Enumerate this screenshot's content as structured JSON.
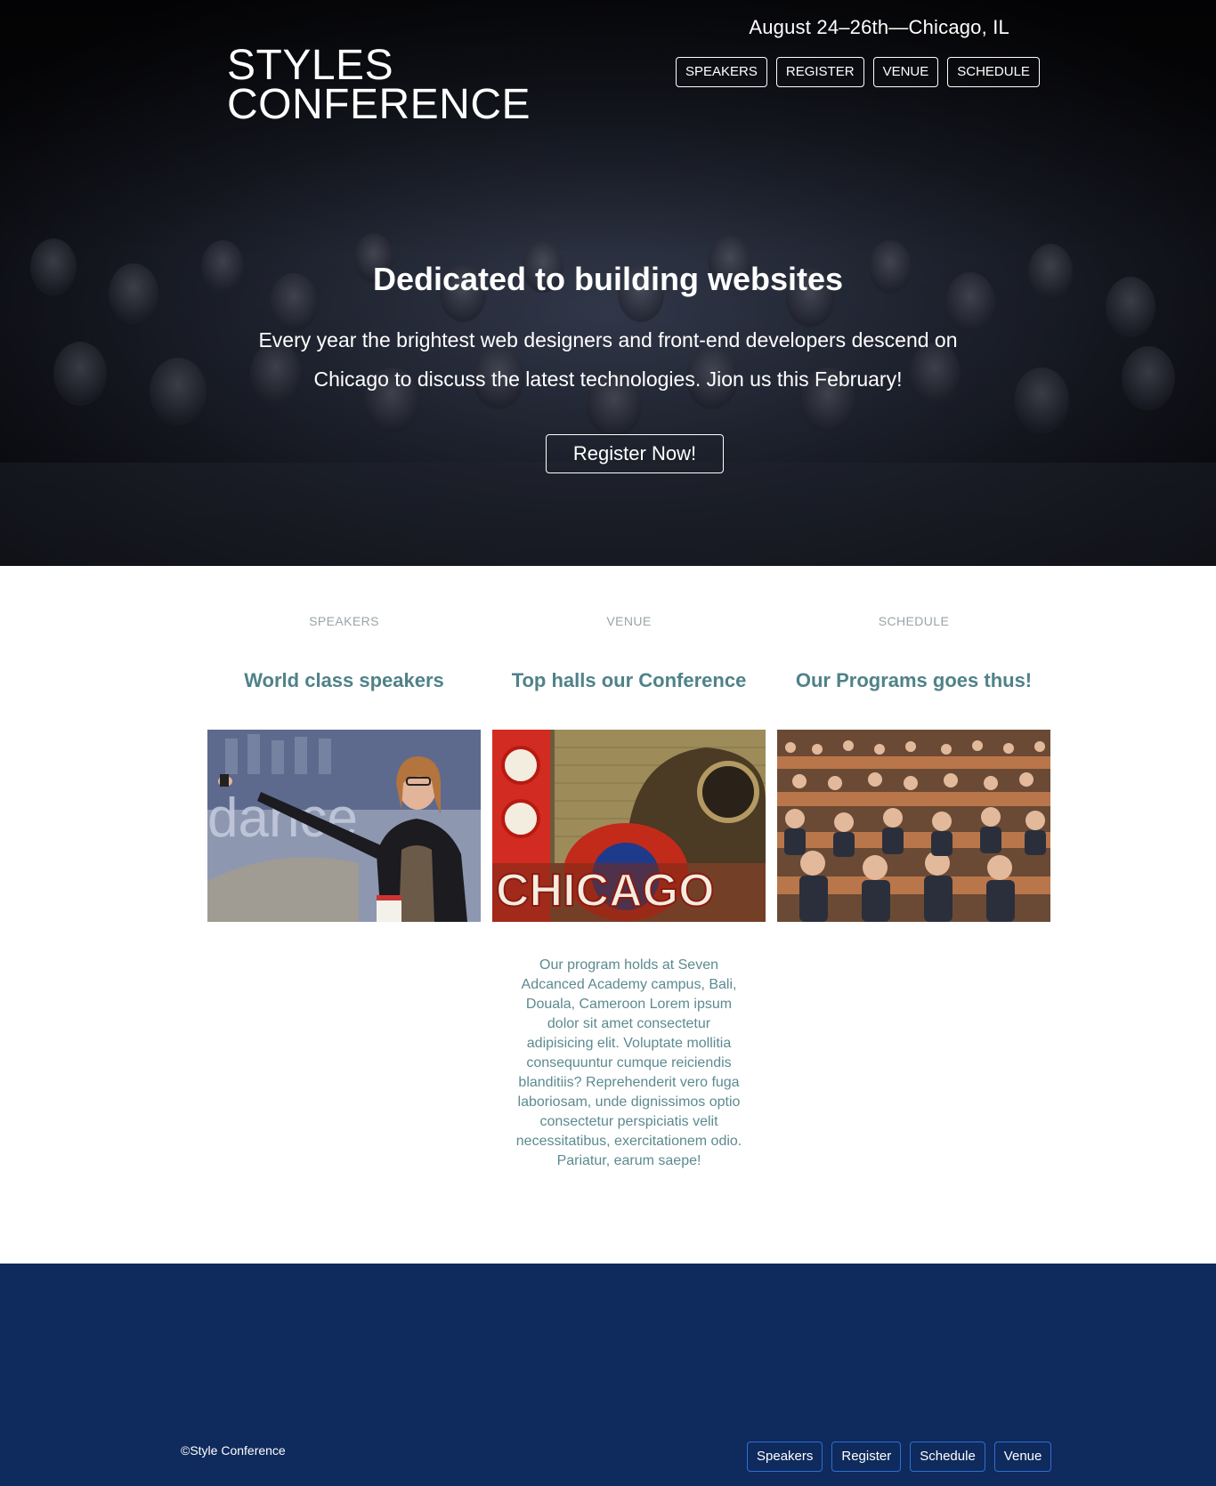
{
  "header": {
    "date_location": "August 24–26th—Chicago, IL",
    "logo_line1": "STYLES",
    "logo_line2": "CONFERENCE",
    "nav": [
      {
        "label": "SPEAKERS"
      },
      {
        "label": "REGISTER"
      },
      {
        "label": "VENUE"
      },
      {
        "label": "SCHEDULE"
      }
    ]
  },
  "hero": {
    "title": "Dedicated to building websites",
    "copy": "Every year the brightest web designers and front-end developers descend on Chicago to discuss the latest technologies. Jion us this February!",
    "cta_label": "Register Now!"
  },
  "features": [
    {
      "eyebrow": "SPEAKERS",
      "heading": "World class speakers",
      "image_icon": "speaker-photo",
      "text": ""
    },
    {
      "eyebrow": "VENUE",
      "heading": "Top halls our Conference",
      "image_icon": "chicago-theatre-photo",
      "text": "Our program holds at Seven Adcanced Academy campus, Bali, Douala, Cameroon Lorem ipsum dolor sit amet consectetur adipisicing elit. Voluptate mollitia consequuntur cumque reiciendis blanditiis? Reprehenderit vero fuga laboriosam, unde dignissimos optio consectetur perspiciatis velit necessitatibus, exercitationem odio. Pariatur, earum saepe!"
    },
    {
      "eyebrow": "SCHEDULE",
      "heading": "Our Programs goes thus!",
      "image_icon": "audience-photo",
      "text": ""
    }
  ],
  "footer": {
    "copyright": "©Style Conference",
    "nav": [
      {
        "label": "Speakers"
      },
      {
        "label": "Register"
      },
      {
        "label": "Schedule"
      },
      {
        "label": "Venue"
      }
    ]
  },
  "colors": {
    "hero_bg": "#060609",
    "feature_heading": "#4f8288",
    "feature_eyebrow": "#9aa4a8",
    "footer_bg": "#0f2a5c",
    "footer_button_border": "#2f6fd6"
  }
}
